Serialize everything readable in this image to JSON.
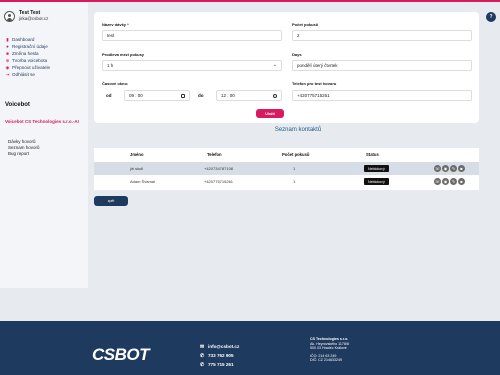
{
  "user": {
    "name": "Test Test",
    "email": "jirka@csbot.cz"
  },
  "menu": [
    {
      "icon": "dashboard-icon",
      "glyph": "▮",
      "label": "Dashboard"
    },
    {
      "icon": "person-icon",
      "glyph": "●",
      "label": "Registrační údaje"
    },
    {
      "icon": "lock-icon",
      "glyph": "■",
      "label": "Změna hesla"
    },
    {
      "icon": "plus-circle-icon",
      "glyph": "⊕",
      "label": "Tvorba voicebota"
    },
    {
      "icon": "switch-user-icon",
      "glyph": "◉",
      "label": "Přepnout uživatele"
    },
    {
      "icon": "logout-icon",
      "glyph": "⇥",
      "label": "Odhlásit se"
    }
  ],
  "section_title": "Voicebot",
  "company": "Voicebot CS Technologies s.r.o.-AI",
  "sub_menu": [
    "Dávky hovorů",
    "Seznam hovorů",
    "Bug report"
  ],
  "form": {
    "batch_name_label": "Název dávky *",
    "batch_name_value": "test",
    "attempts_label": "Počet pokusů",
    "attempts_value": "2",
    "interval_label": "Prodleva mezi pokusy",
    "interval_value": "1 h",
    "days_label": "Days",
    "days_value": "pondělí úterý čtvrtek",
    "time_label": "Časové okno:",
    "from_label": "od",
    "from_value": "09 : 00",
    "to_label": "do",
    "to_value": "12 : 00",
    "phone_label": "Telefon pro test hovoru",
    "phone_value": "+420775715261",
    "add_button": "Uložit"
  },
  "list_title": "Seznam kontaktů",
  "table": {
    "headers": [
      "Jméno",
      "Telefon",
      "Počet pokusů",
      "Status"
    ],
    "rows": [
      {
        "name": "jiri skoll",
        "phone": "+420734787108",
        "attempts": "1",
        "status": "Neblokový"
      },
      {
        "name": "Adam Švamal",
        "phone": "+420775715261",
        "attempts": "1",
        "status": "Neblokový"
      }
    ]
  },
  "back_button": "zpět",
  "help_label": "?",
  "footer": {
    "logo": "CSBOT",
    "email": "info@csbot.cz",
    "phone1": "733 762 905",
    "phone2": "775 715 261",
    "company_name": "CS Technologies s.r.o.",
    "street": "Ak. Heyrovského 1178/8",
    "city": "500 03 Hradec Králové",
    "ico": "IČO: 214 63 249",
    "dic": "DIČ: CZ 214633249"
  }
}
